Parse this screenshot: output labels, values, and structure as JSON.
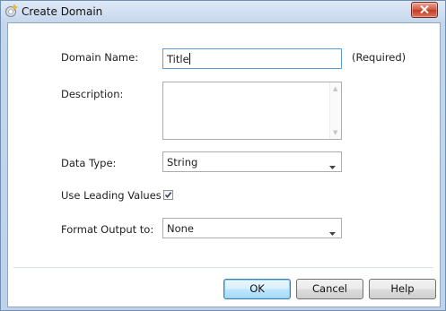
{
  "window": {
    "title": "Create Domain"
  },
  "form": {
    "domain_name_label": "Domain Name:",
    "domain_name_value": "Title",
    "required_note": "(Required)",
    "description_label": "Description:",
    "description_value": "",
    "data_type_label": "Data Type:",
    "data_type_value": "String",
    "use_leading_values_label": "Use Leading Values",
    "use_leading_values_checked": true,
    "format_output_label": "Format Output to:",
    "format_output_value": "None"
  },
  "buttons": {
    "ok": "OK",
    "cancel": "Cancel",
    "help": "Help"
  },
  "icons": {
    "app": "domain-wizard-icon",
    "close": "close-icon",
    "dropdown": "chevron-down-icon",
    "check": "checkmark-icon"
  }
}
